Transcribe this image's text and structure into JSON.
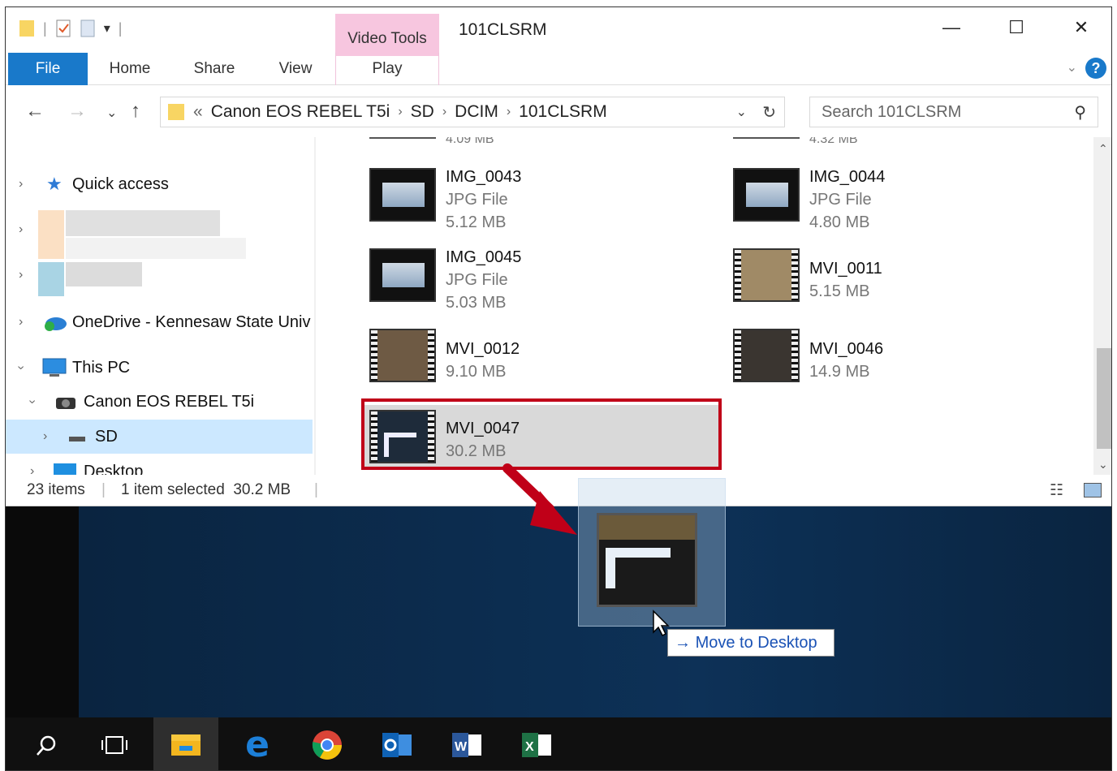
{
  "window": {
    "title": "101CLSRM",
    "context_tab_group": "Video Tools",
    "controls": {
      "minimize": "—",
      "maximize": "☐",
      "close": "✕"
    }
  },
  "ribbon": {
    "tabs": [
      "File",
      "Home",
      "Share",
      "View",
      "Play"
    ]
  },
  "address": {
    "prefix": "«",
    "crumbs": [
      "Canon EOS REBEL T5i",
      "SD",
      "DCIM",
      "101CLSRM"
    ],
    "search_placeholder": "Search 101CLSRM"
  },
  "nav": {
    "items": [
      {
        "label": "Quick access"
      },
      {
        "label": "OneDrive - Kennesaw State Univ"
      },
      {
        "label": "This PC"
      },
      {
        "label": "Canon EOS REBEL T5i"
      },
      {
        "label": "SD"
      },
      {
        "label": "Desktop"
      }
    ]
  },
  "files": {
    "partial_left": "4.09 MB",
    "partial_right": "4.32 MB",
    "items": [
      {
        "name": "IMG_0043",
        "type": "JPG File",
        "size": "5.12 MB"
      },
      {
        "name": "IMG_0044",
        "type": "JPG File",
        "size": "4.80 MB"
      },
      {
        "name": "IMG_0045",
        "type": "JPG File",
        "size": "5.03 MB"
      },
      {
        "name": "MVI_0011",
        "size": "5.15 MB"
      },
      {
        "name": "MVI_0012",
        "size": "9.10 MB"
      },
      {
        "name": "MVI_0046",
        "size": "14.9 MB"
      },
      {
        "name": "MVI_0047",
        "size": "30.2 MB"
      }
    ]
  },
  "status": {
    "count": "23 items",
    "selection": "1 item selected  30.2 MB"
  },
  "drag": {
    "tooltip_arrow": "→",
    "tooltip": "Move to Desktop"
  },
  "taskbar": {
    "icons": [
      "search-icon",
      "task-view-icon",
      "file-explorer-icon",
      "edge-icon",
      "chrome-icon",
      "outlook-icon",
      "word-icon",
      "excel-icon"
    ]
  }
}
